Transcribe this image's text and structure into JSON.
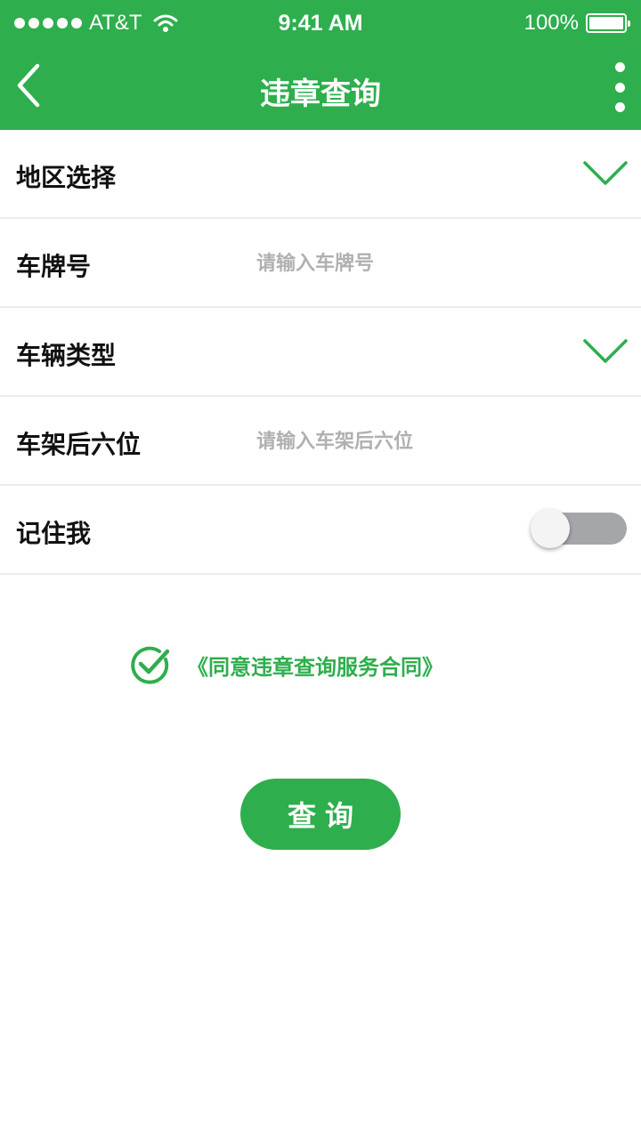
{
  "status_bar": {
    "carrier": "AT&T",
    "time": "9:41 AM",
    "battery": "100%"
  },
  "nav": {
    "title": "违章查询"
  },
  "form": {
    "region_label": "地区选择",
    "plate_label": "车牌号",
    "plate_placeholder": "请输入车牌号",
    "vehicle_type_label": "车辆类型",
    "vin_label": "车架后六位",
    "vin_placeholder": "请输入车架后六位",
    "remember_label": "记住我",
    "remember_on": false
  },
  "agreement": {
    "text": "《同意违章查询服务合同》",
    "checked": true
  },
  "actions": {
    "query_label": "查询"
  },
  "colors": {
    "brand": "#2eae4d",
    "toggle_off": "#a5a6a9",
    "placeholder": "#b0b0b0"
  }
}
